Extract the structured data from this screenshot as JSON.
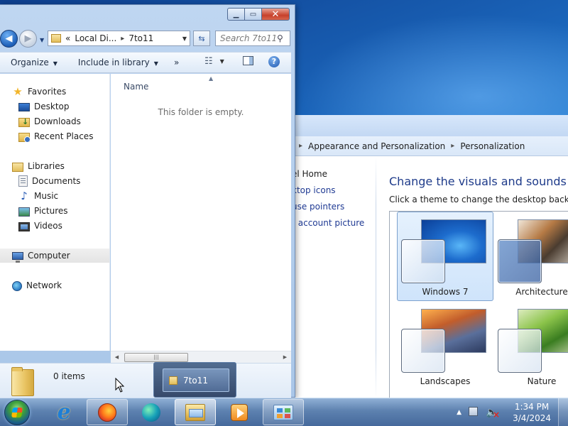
{
  "explorer": {
    "address": {
      "overflow": "«",
      "crumbs": [
        "Local Di...",
        "7to11"
      ]
    },
    "search_placeholder": "Search 7to11",
    "toolbar": {
      "organize": "Organize",
      "include_in_library": "Include in library",
      "more": "»"
    },
    "nav": {
      "favorites": "Favorites",
      "desktop": "Desktop",
      "downloads": "Downloads",
      "recent_places": "Recent Places",
      "libraries": "Libraries",
      "documents": "Documents",
      "music": "Music",
      "pictures": "Pictures",
      "videos": "Videos",
      "computer": "Computer",
      "network": "Network"
    },
    "column_name": "Name",
    "empty_message": "This folder is empty.",
    "status_items": "0 items"
  },
  "thumbnail": {
    "label": "7to11"
  },
  "control_panel": {
    "breadcrumb": [
      "Appearance and Personalization",
      "Personalization"
    ],
    "left_links": [
      "el Home",
      "ktop icons",
      "use pointers",
      "r account picture"
    ],
    "heading": "Change the visuals and sounds on yo",
    "subtitle": "Click a theme to change the desktop backgroun",
    "themes": [
      "Windows 7",
      "Architecture",
      "Landscapes",
      "Nature"
    ]
  },
  "tray": {
    "time": "1:34 PM",
    "date": "3/4/2024"
  }
}
